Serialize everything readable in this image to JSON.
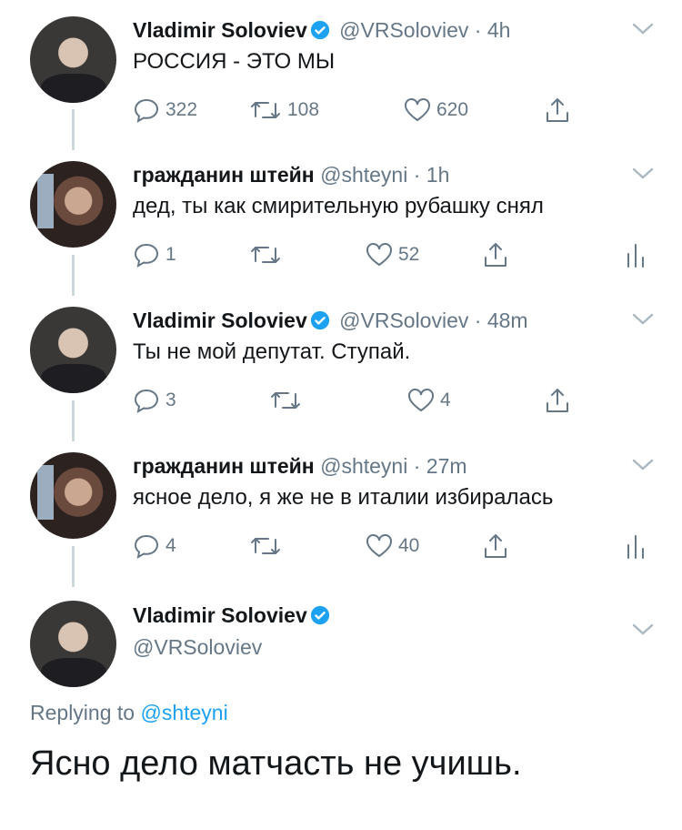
{
  "tweets": [
    {
      "name": "Vladimir Soloviev",
      "handle": "@VRSoloviev",
      "time": "4h",
      "text": "РОССИЯ - ЭТО МЫ",
      "replies": "322",
      "retweets": "108",
      "likes": "620",
      "verified": true
    },
    {
      "name": "гражданин штейн",
      "handle": "@shteyni",
      "time": "1h",
      "text": "дед, ты как смирительную рубашку снял",
      "replies": "1",
      "retweets": "",
      "likes": "52",
      "verified": false
    },
    {
      "name": "Vladimir Soloviev",
      "handle": "@VRSoloviev",
      "time": "48m",
      "text": "Ты не мой депутат. Ступай.",
      "replies": "3",
      "retweets": "",
      "likes": "4",
      "verified": true
    },
    {
      "name": "гражданин штейн",
      "handle": "@shteyni",
      "time": "27m",
      "text": "ясное дело, я же не в италии избиралась",
      "replies": "4",
      "retweets": "",
      "likes": "40",
      "verified": false
    }
  ],
  "main_tweet": {
    "name": "Vladimir Soloviev",
    "handle": "@VRSoloviev",
    "replying_prefix": "Replying to",
    "replying_to": "@shteyni",
    "text": "Ясно дело матчасть не учишь."
  },
  "separator": "·",
  "colors": {
    "verified": "#1da1f2",
    "muted": "#657786",
    "link": "#1da1f2",
    "thread_line": "#ccd6dd"
  },
  "icons": [
    "reply-icon",
    "retweet-icon",
    "like-icon",
    "share-icon",
    "analytics-icon",
    "chevron-down-icon",
    "verified-badge-icon"
  ]
}
